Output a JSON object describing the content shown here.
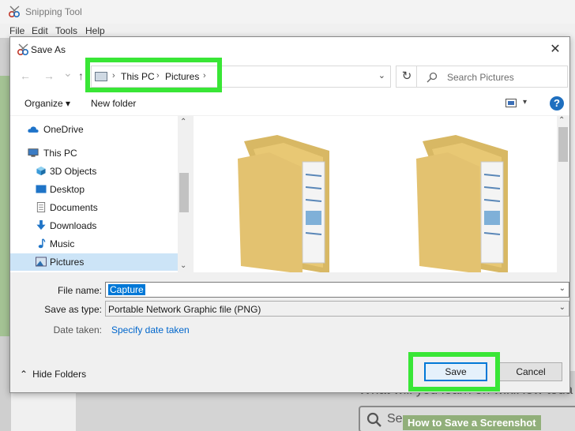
{
  "background": {
    "app_title": "Snipping Tool",
    "menu": [
      "File",
      "Edit",
      "Tools",
      "Help"
    ],
    "web_heading": "What will you learn on wikiHow toda",
    "web_search_text": "Se",
    "watermark": "How to Save a Screenshot"
  },
  "dialog": {
    "title": "Save As",
    "close_glyph": "✕"
  },
  "navigation": {
    "back_glyph": "←",
    "forward_glyph": "→",
    "recent_glyph": "⌄",
    "up_glyph": "↑",
    "breadcrumb": [
      "This PC",
      "Pictures"
    ],
    "refresh_glyph": "↻",
    "search_placeholder": "Search Pictures"
  },
  "toolbar": {
    "organize_label": "Organize ▾",
    "new_folder_label": "New folder",
    "help_glyph": "?"
  },
  "nav_pane": {
    "items": [
      {
        "label": "OneDrive",
        "icon": "cloud-icon"
      },
      {
        "label": "This PC",
        "icon": "computer-icon"
      },
      {
        "label": "3D Objects",
        "icon": "cube-icon"
      },
      {
        "label": "Desktop",
        "icon": "desktop-icon"
      },
      {
        "label": "Documents",
        "icon": "documents-icon"
      },
      {
        "label": "Downloads",
        "icon": "download-icon"
      },
      {
        "label": "Music",
        "icon": "music-icon"
      },
      {
        "label": "Pictures",
        "icon": "pictures-icon",
        "selected": true
      }
    ]
  },
  "form": {
    "file_name_label": "File name:",
    "file_name_value": "Capture",
    "save_type_label": "Save as type:",
    "save_type_value": "Portable Network Graphic file (PNG)",
    "date_taken_label": "Date taken:",
    "date_taken_link": "Specify date taken",
    "hide_folders_label": "Hide Folders",
    "save_label": "Save",
    "cancel_label": "Cancel"
  },
  "colors": {
    "highlight_green": "#39e636",
    "accent_blue": "#0078d7",
    "folder_yellow": "#e8c874"
  }
}
